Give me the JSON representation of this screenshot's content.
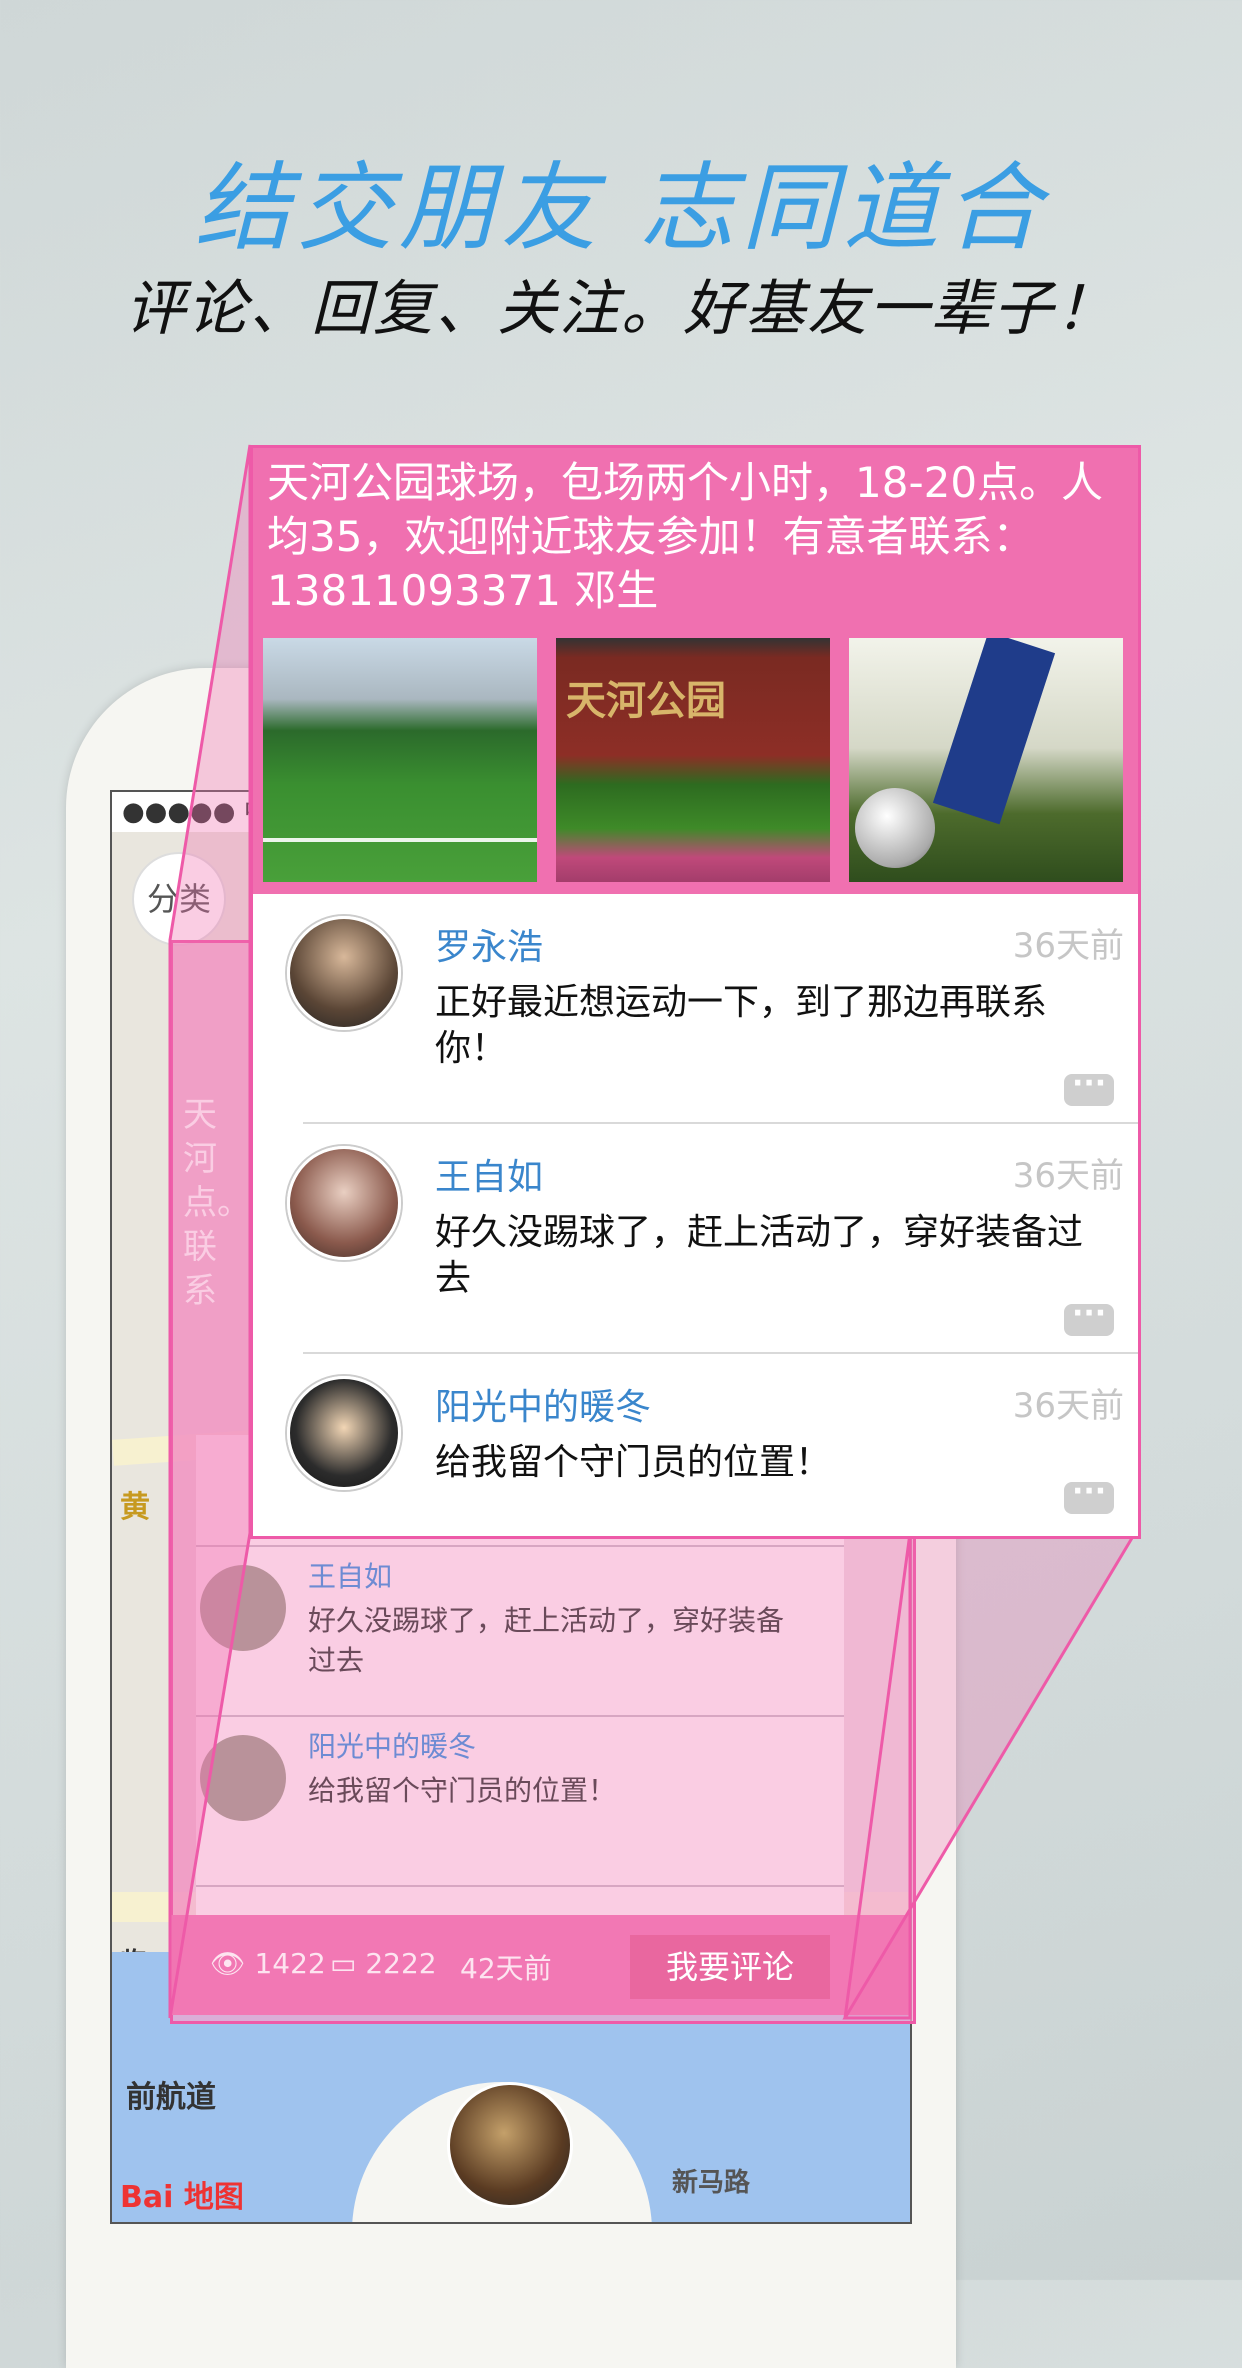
{
  "header": {
    "title": "结交朋友 志同道合",
    "subtitle": "评论、回复、关注。好基友一辈子！"
  },
  "phone_bg": {
    "status_text": "●●●●● 中",
    "category_button": "分类",
    "map_label_road": "前航道",
    "map_label_road2": "新马路",
    "map_label_yellow": "黄",
    "map_label_lin": "临",
    "baidu": "Bai 地图",
    "back_card_text": "天河\n点。\n联系"
  },
  "back_card": {
    "comments": [
      {
        "name": "",
        "text": "你！",
        "time": ""
      },
      {
        "name": "王自如",
        "text": "好久没踢球了，赶上活动了，穿好装备过去",
        "time": "36天前"
      },
      {
        "name": "阳光中的暖冬",
        "text": "给我留个守门员的位置！",
        "time": "36天前"
      }
    ],
    "views": "1422",
    "comments_count": "2222",
    "time": "42天前",
    "comment_button": "我要评论"
  },
  "post": {
    "text": "天河公园球场，包场两个小时，18-20点。人均35，欢迎附近球友参加！有意者联系：13811093371 邓生",
    "photo2_label": "天河公园"
  },
  "comments": [
    {
      "name": "罗永浩",
      "time": "36天前",
      "text": "正好最近想运动一下，到了那边再联系你！"
    },
    {
      "name": "王自如",
      "time": "36天前",
      "text": "好久没踢球了，赶上活动了，穿好装备过去"
    },
    {
      "name": "阳光中的暖冬",
      "time": "36天前",
      "text": "给我留个守门员的位置！"
    }
  ],
  "colors": {
    "accent_blue": "#3b9ee3",
    "pink": "#f070b0",
    "pink_border": "#ee5aa8",
    "name_blue": "#3a86cc"
  }
}
